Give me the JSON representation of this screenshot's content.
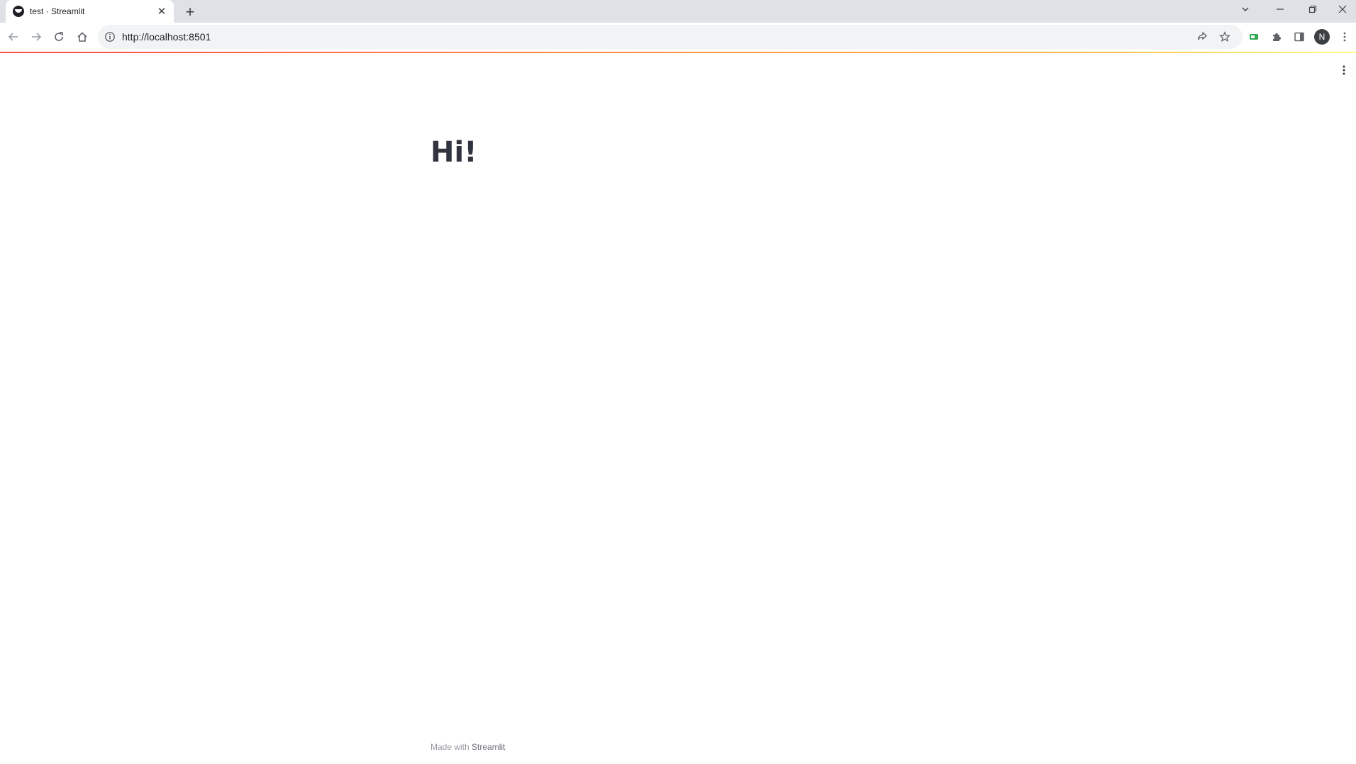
{
  "browser": {
    "tab": {
      "title": "test · Streamlit",
      "close_glyph": "✕"
    },
    "new_tab_glyph": "+",
    "window_controls": {
      "tab_search_icon": "chevron-down-icon",
      "minimize_icon": "minimize-icon",
      "restore_icon": "restore-icon",
      "close_icon": "close-icon"
    },
    "toolbar": {
      "url": "http://localhost:8501",
      "profile_initial": "N"
    }
  },
  "app": {
    "title": "Hi!",
    "footer": {
      "prefix": "Made with",
      "link": "Streamlit"
    }
  },
  "colors": {
    "heading": "#31333f",
    "decoration_start": "#ff4b4b",
    "decoration_mid": "#ffbd45",
    "decoration_end": "#fffd80",
    "extension_green": "#34a853"
  }
}
